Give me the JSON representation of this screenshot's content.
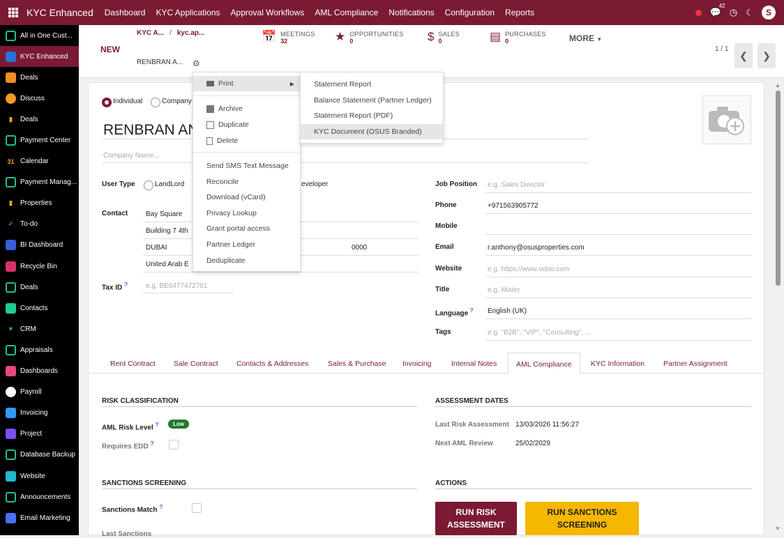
{
  "topbar": {
    "brand": "KYC Enhanced",
    "menu": [
      "Dashboard",
      "KYC Applications",
      "Approval Workflows",
      "AML Compliance",
      "Notifications",
      "Configuration",
      "Reports"
    ],
    "chat_count": "42"
  },
  "sidebar": {
    "items": [
      {
        "label": "All in One Cust...",
        "icon": "cube-icon",
        "color": "#1ec28b"
      },
      {
        "label": "KYC Enhanced",
        "icon": "kyc-icon",
        "color": "#2a6fdb"
      },
      {
        "label": "Deals",
        "icon": "deals-icon",
        "color": "#f28c28"
      },
      {
        "label": "Discuss",
        "icon": "discuss-icon",
        "color": "#f59b24"
      },
      {
        "label": "Deals",
        "icon": "tag-icon",
        "color": "#f5a623"
      },
      {
        "label": "Payment Center",
        "icon": "cube-icon",
        "color": "#1ec28b"
      },
      {
        "label": "Calendar",
        "icon": "calendar-icon",
        "color": "#f5a623"
      },
      {
        "label": "Payment Manag...",
        "icon": "cube-icon",
        "color": "#1ec28b"
      },
      {
        "label": "Properties",
        "icon": "tag-icon",
        "color": "#f5a623"
      },
      {
        "label": "To-do",
        "icon": "todo-icon",
        "color": "#2196f3"
      },
      {
        "label": "BI Dashboard",
        "icon": "bi-icon",
        "color": "#3b5bdb"
      },
      {
        "label": "Recycle Bin",
        "icon": "recycle-icon",
        "color": "#d6336c"
      },
      {
        "label": "Deals",
        "icon": "cube-icon",
        "color": "#1ec28b"
      },
      {
        "label": "Contacts",
        "icon": "contacts-icon",
        "color": "#20c997"
      },
      {
        "label": "CRM",
        "icon": "crm-icon",
        "color": "#12b886"
      },
      {
        "label": "Appraisals",
        "icon": "cube-icon",
        "color": "#1ec28b"
      },
      {
        "label": "Dashboards",
        "icon": "dashboards-icon",
        "color": "#e64980"
      },
      {
        "label": "Payroll",
        "icon": "payroll-icon",
        "color": "#ffffff"
      },
      {
        "label": "Invoicing",
        "icon": "invoicing-icon",
        "color": "#339af0"
      },
      {
        "label": "Project",
        "icon": "project-icon",
        "color": "#7950f2"
      },
      {
        "label": "Database Backup",
        "icon": "cube-icon",
        "color": "#1ec28b"
      },
      {
        "label": "Website",
        "icon": "website-icon",
        "color": "#22b8cf"
      },
      {
        "label": "Announcements",
        "icon": "cube-icon",
        "color": "#1ec28b"
      },
      {
        "label": "Email Marketing",
        "icon": "email-icon",
        "color": "#4c6ef5"
      }
    ]
  },
  "control_panel": {
    "new_label": "NEW",
    "breadcrumb": [
      "KYC A...",
      "/",
      "kyc.ap..."
    ],
    "record_name": "RENBRAN A...",
    "stats": [
      {
        "label": "MEETINGS",
        "value": "32",
        "icon": "calendar-icon"
      },
      {
        "label": "OPPORTUNITIES",
        "value": "0",
        "icon": "star-icon"
      },
      {
        "label": "SALES",
        "value": "0",
        "icon": "dollar-icon"
      },
      {
        "label": "PURCHASES",
        "value": "0",
        "icon": "credit-card-icon"
      }
    ],
    "more_label": "MORE",
    "pager": "1 / 1"
  },
  "form": {
    "type_individual": "Individual",
    "type_company": "Company",
    "name": "RENBRAN AN",
    "company_placeholder": "Company Name...",
    "user_type_label": "User Type",
    "user_type_landlord": "LandLord",
    "user_type_developer": "eveloper",
    "contact_label": "Contact",
    "street": "Bay Square",
    "street2": "Building 7 4th",
    "city": "DUBAI",
    "zip": "0000",
    "country": "United Arab E",
    "tax_label": "Tax ID",
    "tax_placeholder": "e.g. BE0477472701",
    "right_fields": [
      {
        "label": "Job Position",
        "value": "",
        "placeholder": "e.g. Sales Director"
      },
      {
        "label": "Phone",
        "value": "+971563905772",
        "placeholder": ""
      },
      {
        "label": "Mobile",
        "value": "",
        "placeholder": ""
      },
      {
        "label": "Email",
        "value": "r.anthony@osusproperties.com",
        "placeholder": ""
      },
      {
        "label": "Website",
        "value": "",
        "placeholder": "e.g. https://www.odoo.com"
      },
      {
        "label": "Title",
        "value": "",
        "placeholder": "e.g. Mister"
      },
      {
        "label": "Language",
        "value": "English (UK)",
        "placeholder": ""
      },
      {
        "label": "Tags",
        "value": "",
        "placeholder": "e.g. \"B2B\", \"VIP\", \"Consulting\", ..."
      }
    ]
  },
  "tabs": [
    "Rent Contract",
    "Sale Contract",
    "Contacts & Addresses",
    "Sales & Purchase",
    "Invoicing",
    "Internal Notes",
    "AML Compliance",
    "KYC Information",
    "Partner Assignment"
  ],
  "aml": {
    "risk_title": "RISK CLASSIFICATION",
    "risk_level_label": "AML Risk Level",
    "risk_level_value": "Low",
    "edd_label": "Requires EDD",
    "dates_title": "ASSESSMENT DATES",
    "last_risk_label": "Last Risk Assessment",
    "last_risk_value": "13/03/2026 11:56:27",
    "next_review_label": "Next AML Review",
    "next_review_value": "25/02/2029",
    "sanctions_title": "SANCTIONS SCREENING",
    "sanctions_match_label": "Sanctions Match",
    "last_sanctions_label": "Last Sanctions",
    "actions_title": "ACTIONS",
    "btn_risk": "RUN RISK ASSESSMENT",
    "btn_sanctions": "RUN SANCTIONS SCREENING"
  },
  "action_menu": {
    "print": "Print",
    "archive": "Archive",
    "duplicate": "Duplicate",
    "delete": "Delete",
    "items2": [
      "Send SMS Text Message",
      "Reconcile",
      "Download (vCard)",
      "Privacy Lookup",
      "Grant portal access",
      "Partner Ledger",
      "Deduplicate"
    ]
  },
  "print_menu": [
    "Statement Report",
    "Balance Statement (Partner Ledger)",
    "Statement Report (PDF)",
    "KYC Document (OSUS Branded)"
  ],
  "colors": {
    "brand": "#7a1a33",
    "badge_low": "#1f7a2d",
    "btn_sanctions": "#f5b700"
  }
}
